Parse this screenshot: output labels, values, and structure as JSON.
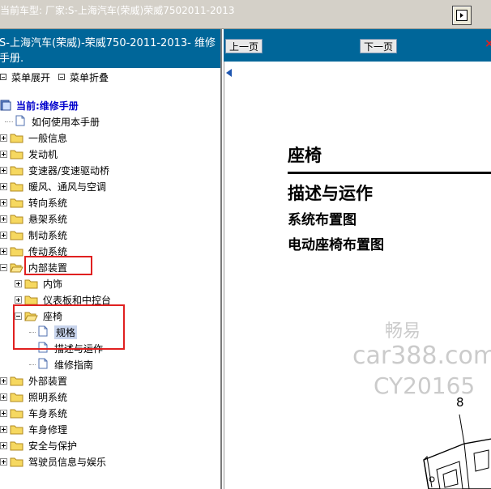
{
  "topbar": {
    "vehicle_text": "当前车型:  厂家:S-上海汽车(荣威)荣威7502011-2013"
  },
  "left_panel": {
    "header_line1": "S-上海汽车(荣威)-荣威750-2011-2013- 维修",
    "header_line2": "手册.",
    "menu_expand": "菜单展开",
    "menu_collapse": "菜单折叠"
  },
  "tree": {
    "current": "当前:维修手册",
    "how_to_use": "如何使用本手册",
    "general_info": "一般信息",
    "engine": "发动机",
    "transmission": "变速器/变速驱动桥",
    "hvac": "暖风、通风与空调",
    "steering": "转向系统",
    "suspension": "悬架系统",
    "brakes": "制动系统",
    "driveline": "传动系统",
    "interior": "内部装置",
    "trim": "内饰",
    "instrument_panel": "仪表板和中控台",
    "seats": "座椅",
    "specs": "规格",
    "description": "描述与运作",
    "repair_guide": "维修指南",
    "exterior": "外部装置",
    "lighting": "照明系统",
    "body_system": "车身系统",
    "body_repair": "车身修理",
    "safety": "安全与保护",
    "driver_info": "驾驶员信息与娱乐"
  },
  "nav": {
    "prev_label": "上一页",
    "next_label": "下一页"
  },
  "document": {
    "title": "座椅",
    "heading": "描述与运作",
    "sub1": "系统布置图",
    "sub2": "电动座椅布置图",
    "figure_number": "8"
  },
  "watermark": {
    "line1": "畅易",
    "line2": "car388.com",
    "line3": "CY20165"
  },
  "colors": {
    "header_blue": "#006699",
    "highlight_red": "#e02020",
    "selected_bg": "#c8d4ec"
  }
}
